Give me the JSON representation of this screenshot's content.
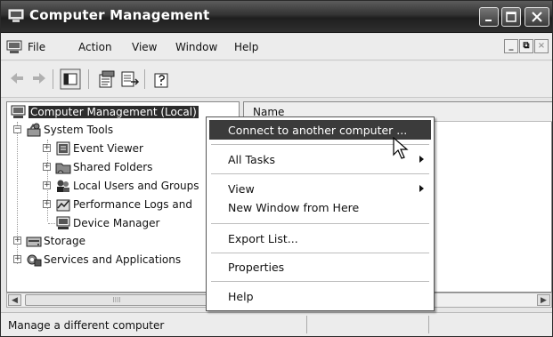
{
  "window": {
    "title": "Computer Management",
    "controls": [
      "minimize-icon",
      "maximize-icon",
      "close-icon"
    ]
  },
  "menubar": {
    "items": [
      "File",
      "Action",
      "View",
      "Window",
      "Help"
    ],
    "mdi_controls": [
      "_",
      "⧉",
      "×"
    ]
  },
  "toolbar": {
    "buttons": [
      "back-arrow-icon",
      "forward-arrow-icon",
      "show-hide-tree-icon",
      "properties-icon",
      "export-list-icon",
      "help-icon"
    ]
  },
  "tree": {
    "root": "Computer Management (Local)",
    "items": [
      {
        "label": "System Tools",
        "icon": "tools-icon",
        "expander": "−"
      },
      {
        "label": "Event Viewer",
        "icon": "event-viewer-icon",
        "expander": "+"
      },
      {
        "label": "Shared Folders",
        "icon": "shared-folders-icon",
        "expander": "+"
      },
      {
        "label": "Local Users and Groups",
        "icon": "users-icon",
        "expander": "+"
      },
      {
        "label": "Performance Logs and",
        "icon": "performance-icon",
        "expander": "+"
      },
      {
        "label": "Device Manager",
        "icon": "device-manager-icon",
        "expander": ""
      },
      {
        "label": "Storage",
        "icon": "storage-icon",
        "expander": "+"
      },
      {
        "label": "Services and Applications",
        "icon": "services-icon",
        "expander": "+"
      }
    ]
  },
  "list": {
    "column_name": "Name"
  },
  "context_menu": {
    "items": [
      {
        "label": "Connect to another computer ...",
        "highlighted": true,
        "submenu": false
      },
      {
        "label": "All Tasks",
        "highlighted": false,
        "submenu": true
      },
      {
        "label": "View",
        "highlighted": false,
        "submenu": true
      },
      {
        "label": "New Window from Here",
        "highlighted": false,
        "submenu": false
      },
      {
        "label": "Export List...",
        "highlighted": false,
        "submenu": false
      },
      {
        "label": "Properties",
        "highlighted": false,
        "submenu": false
      },
      {
        "label": "Help",
        "highlighted": false,
        "submenu": false
      }
    ]
  },
  "scrollbar": {
    "thumb_grip": "IIII"
  },
  "statusbar": {
    "text": "Manage a different computer"
  },
  "colors": {
    "titlebar": "#2e2e2e",
    "highlight": "#3b3b3b",
    "selected_tree_item": "#2c2c2c"
  }
}
